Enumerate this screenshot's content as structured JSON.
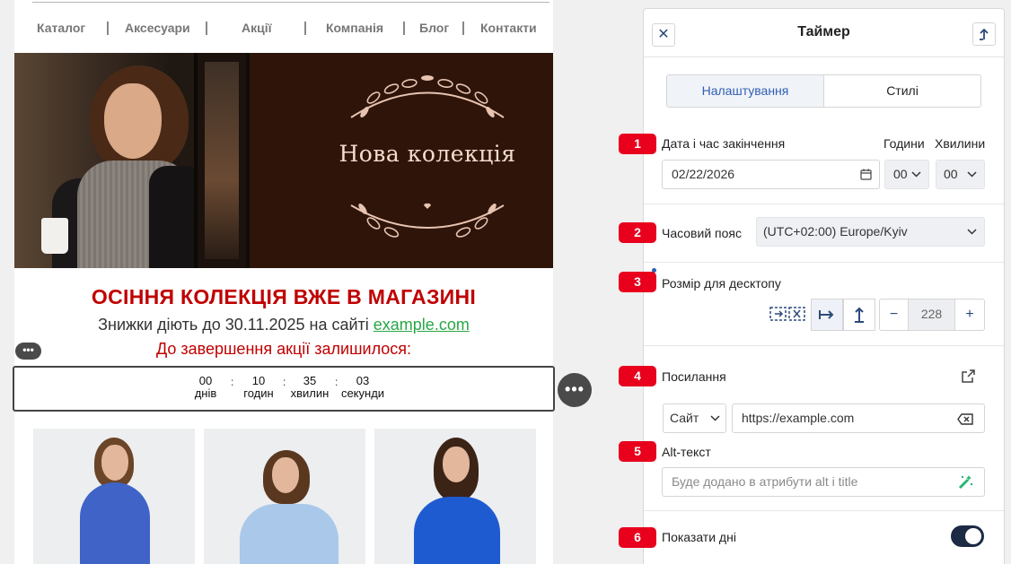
{
  "email": {
    "nav": [
      "Каталог",
      "Аксесуари",
      "Акції",
      "Компанія",
      "Блог",
      "Контакти"
    ],
    "banner_title": "Нова колекція",
    "headline": "ОСІННЯ КОЛЕКЦІЯ ВЖЕ В МАГАЗИНІ",
    "sub_prefix": "Знижки діють до 30.11.2025 на сайті ",
    "sub_link": "example.com",
    "remain_text": "До завершення акції залишилося:",
    "timer": {
      "days": "00",
      "days_label": "днів",
      "hours": "10",
      "hours_label": "годин",
      "minutes": "35",
      "minutes_label": "хвилин",
      "seconds": "03",
      "seconds_label": "секунди",
      "separator": ":"
    },
    "handle_glyph": "•••",
    "more_glyph": "•••"
  },
  "panel": {
    "title": "Таймер",
    "close_glyph": "✕",
    "tabs": {
      "settings": "Налаштування",
      "styles": "Стилі"
    },
    "badges": [
      "1",
      "2",
      "3",
      "4",
      "5",
      "6"
    ],
    "end_date": {
      "label": "Дата і час закінчення",
      "hours_label": "Години",
      "minutes_label": "Хвилини",
      "date_value": "02/22/2026",
      "hours_value": "00",
      "minutes_value": "00"
    },
    "timezone": {
      "label": "Часовий пояс",
      "value": "(UTC+02:00) Europe/Kyiv"
    },
    "desktop_size": {
      "label": "Розмір для десктопу",
      "value": "228",
      "minus": "−",
      "plus": "+"
    },
    "link": {
      "label": "Посилання",
      "type_value": "Сайт",
      "url_value": "https://example.com"
    },
    "alt": {
      "label": "Alt-текст",
      "placeholder": "Буде додано в атрибути alt і title"
    },
    "show_days": {
      "label": "Показати дні",
      "enabled": true
    }
  },
  "colors": {
    "accent_red": "#c00000",
    "link_green": "#28a745",
    "badge_red": "#e8001c",
    "tab_active_blue": "#2f5fb3",
    "toggle_dark": "#1d2a44"
  }
}
